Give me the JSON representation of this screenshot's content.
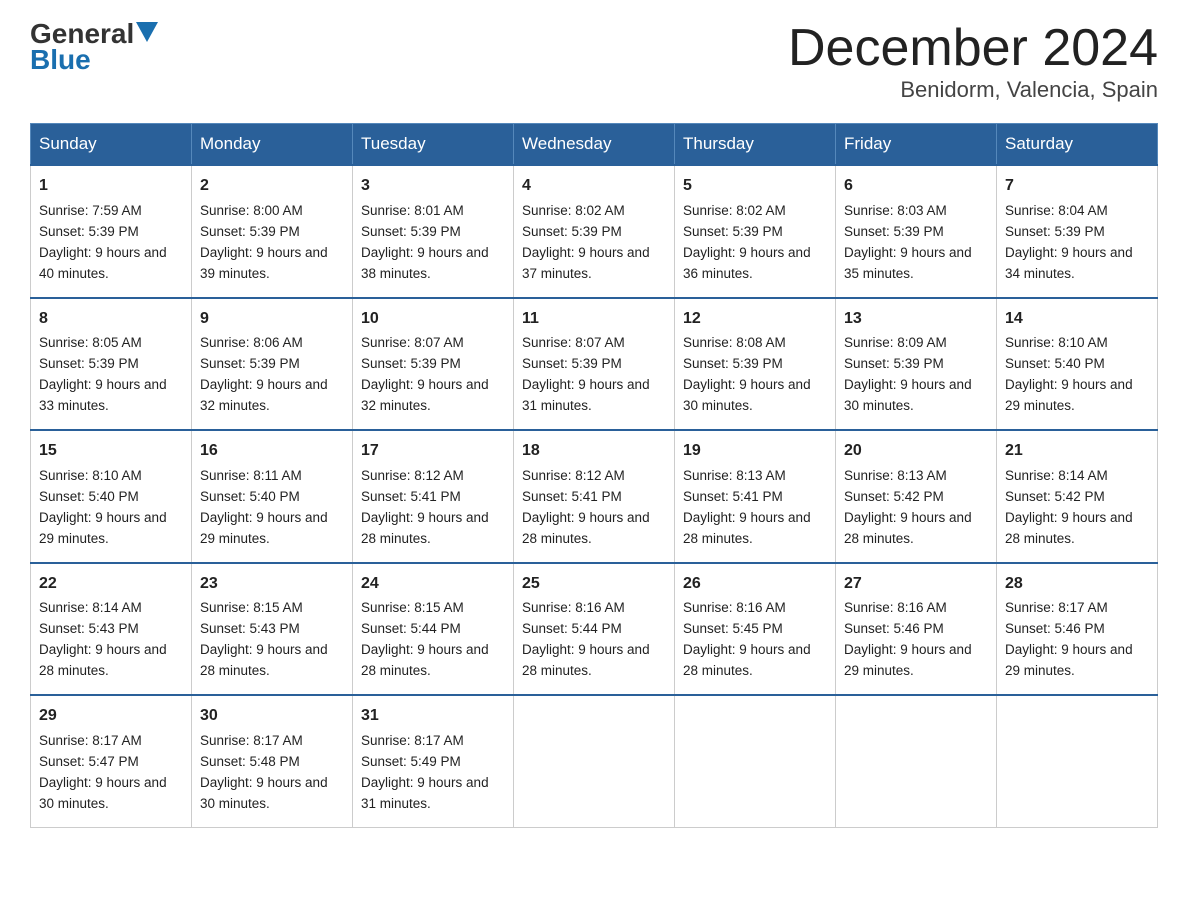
{
  "header": {
    "logo_general": "General",
    "logo_blue": "Blue",
    "title": "December 2024",
    "subtitle": "Benidorm, Valencia, Spain"
  },
  "days_of_week": [
    "Sunday",
    "Monday",
    "Tuesday",
    "Wednesday",
    "Thursday",
    "Friday",
    "Saturday"
  ],
  "weeks": [
    [
      {
        "day": "1",
        "sunrise": "Sunrise: 7:59 AM",
        "sunset": "Sunset: 5:39 PM",
        "daylight": "Daylight: 9 hours and 40 minutes."
      },
      {
        "day": "2",
        "sunrise": "Sunrise: 8:00 AM",
        "sunset": "Sunset: 5:39 PM",
        "daylight": "Daylight: 9 hours and 39 minutes."
      },
      {
        "day": "3",
        "sunrise": "Sunrise: 8:01 AM",
        "sunset": "Sunset: 5:39 PM",
        "daylight": "Daylight: 9 hours and 38 minutes."
      },
      {
        "day": "4",
        "sunrise": "Sunrise: 8:02 AM",
        "sunset": "Sunset: 5:39 PM",
        "daylight": "Daylight: 9 hours and 37 minutes."
      },
      {
        "day": "5",
        "sunrise": "Sunrise: 8:02 AM",
        "sunset": "Sunset: 5:39 PM",
        "daylight": "Daylight: 9 hours and 36 minutes."
      },
      {
        "day": "6",
        "sunrise": "Sunrise: 8:03 AM",
        "sunset": "Sunset: 5:39 PM",
        "daylight": "Daylight: 9 hours and 35 minutes."
      },
      {
        "day": "7",
        "sunrise": "Sunrise: 8:04 AM",
        "sunset": "Sunset: 5:39 PM",
        "daylight": "Daylight: 9 hours and 34 minutes."
      }
    ],
    [
      {
        "day": "8",
        "sunrise": "Sunrise: 8:05 AM",
        "sunset": "Sunset: 5:39 PM",
        "daylight": "Daylight: 9 hours and 33 minutes."
      },
      {
        "day": "9",
        "sunrise": "Sunrise: 8:06 AM",
        "sunset": "Sunset: 5:39 PM",
        "daylight": "Daylight: 9 hours and 32 minutes."
      },
      {
        "day": "10",
        "sunrise": "Sunrise: 8:07 AM",
        "sunset": "Sunset: 5:39 PM",
        "daylight": "Daylight: 9 hours and 32 minutes."
      },
      {
        "day": "11",
        "sunrise": "Sunrise: 8:07 AM",
        "sunset": "Sunset: 5:39 PM",
        "daylight": "Daylight: 9 hours and 31 minutes."
      },
      {
        "day": "12",
        "sunrise": "Sunrise: 8:08 AM",
        "sunset": "Sunset: 5:39 PM",
        "daylight": "Daylight: 9 hours and 30 minutes."
      },
      {
        "day": "13",
        "sunrise": "Sunrise: 8:09 AM",
        "sunset": "Sunset: 5:39 PM",
        "daylight": "Daylight: 9 hours and 30 minutes."
      },
      {
        "day": "14",
        "sunrise": "Sunrise: 8:10 AM",
        "sunset": "Sunset: 5:40 PM",
        "daylight": "Daylight: 9 hours and 29 minutes."
      }
    ],
    [
      {
        "day": "15",
        "sunrise": "Sunrise: 8:10 AM",
        "sunset": "Sunset: 5:40 PM",
        "daylight": "Daylight: 9 hours and 29 minutes."
      },
      {
        "day": "16",
        "sunrise": "Sunrise: 8:11 AM",
        "sunset": "Sunset: 5:40 PM",
        "daylight": "Daylight: 9 hours and 29 minutes."
      },
      {
        "day": "17",
        "sunrise": "Sunrise: 8:12 AM",
        "sunset": "Sunset: 5:41 PM",
        "daylight": "Daylight: 9 hours and 28 minutes."
      },
      {
        "day": "18",
        "sunrise": "Sunrise: 8:12 AM",
        "sunset": "Sunset: 5:41 PM",
        "daylight": "Daylight: 9 hours and 28 minutes."
      },
      {
        "day": "19",
        "sunrise": "Sunrise: 8:13 AM",
        "sunset": "Sunset: 5:41 PM",
        "daylight": "Daylight: 9 hours and 28 minutes."
      },
      {
        "day": "20",
        "sunrise": "Sunrise: 8:13 AM",
        "sunset": "Sunset: 5:42 PM",
        "daylight": "Daylight: 9 hours and 28 minutes."
      },
      {
        "day": "21",
        "sunrise": "Sunrise: 8:14 AM",
        "sunset": "Sunset: 5:42 PM",
        "daylight": "Daylight: 9 hours and 28 minutes."
      }
    ],
    [
      {
        "day": "22",
        "sunrise": "Sunrise: 8:14 AM",
        "sunset": "Sunset: 5:43 PM",
        "daylight": "Daylight: 9 hours and 28 minutes."
      },
      {
        "day": "23",
        "sunrise": "Sunrise: 8:15 AM",
        "sunset": "Sunset: 5:43 PM",
        "daylight": "Daylight: 9 hours and 28 minutes."
      },
      {
        "day": "24",
        "sunrise": "Sunrise: 8:15 AM",
        "sunset": "Sunset: 5:44 PM",
        "daylight": "Daylight: 9 hours and 28 minutes."
      },
      {
        "day": "25",
        "sunrise": "Sunrise: 8:16 AM",
        "sunset": "Sunset: 5:44 PM",
        "daylight": "Daylight: 9 hours and 28 minutes."
      },
      {
        "day": "26",
        "sunrise": "Sunrise: 8:16 AM",
        "sunset": "Sunset: 5:45 PM",
        "daylight": "Daylight: 9 hours and 28 minutes."
      },
      {
        "day": "27",
        "sunrise": "Sunrise: 8:16 AM",
        "sunset": "Sunset: 5:46 PM",
        "daylight": "Daylight: 9 hours and 29 minutes."
      },
      {
        "day": "28",
        "sunrise": "Sunrise: 8:17 AM",
        "sunset": "Sunset: 5:46 PM",
        "daylight": "Daylight: 9 hours and 29 minutes."
      }
    ],
    [
      {
        "day": "29",
        "sunrise": "Sunrise: 8:17 AM",
        "sunset": "Sunset: 5:47 PM",
        "daylight": "Daylight: 9 hours and 30 minutes."
      },
      {
        "day": "30",
        "sunrise": "Sunrise: 8:17 AM",
        "sunset": "Sunset: 5:48 PM",
        "daylight": "Daylight: 9 hours and 30 minutes."
      },
      {
        "day": "31",
        "sunrise": "Sunrise: 8:17 AM",
        "sunset": "Sunset: 5:49 PM",
        "daylight": "Daylight: 9 hours and 31 minutes."
      },
      null,
      null,
      null,
      null
    ]
  ]
}
